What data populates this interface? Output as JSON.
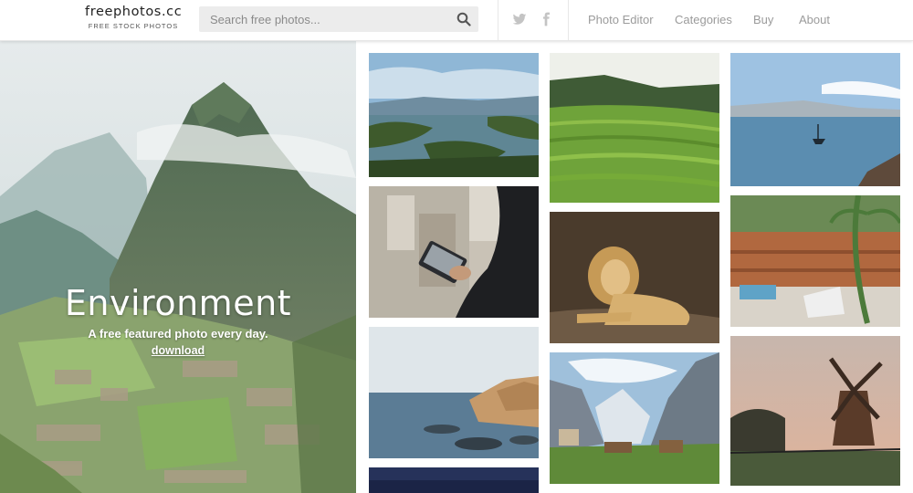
{
  "header": {
    "logo_name": "freephotos.cc",
    "logo_tagline": "FREE STOCK PHOTOS",
    "search_placeholder": "Search free photos...",
    "social": [
      "twitter-icon",
      "facebook-icon"
    ],
    "nav": [
      "Photo Editor",
      "Categories",
      "Buy",
      "About"
    ]
  },
  "hero": {
    "title": "Environment",
    "subtitle": "A free featured photo every day.",
    "link": "download"
  },
  "colors": {
    "header_bg": "#ffffff",
    "search_bg": "#ececec",
    "nav_text": "#9b9b9b",
    "hero_text": "#ffffff"
  }
}
